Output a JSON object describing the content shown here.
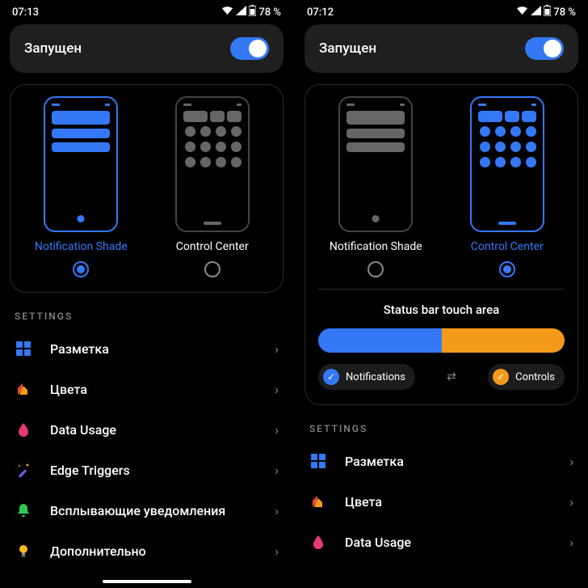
{
  "left": {
    "status": {
      "time": "07:13",
      "battery": "78 %"
    },
    "running_label": "Запущен",
    "modes": {
      "notif": "Notification Shade",
      "cc": "Control Center",
      "selected": "notif"
    },
    "settings_header": "SETTINGS",
    "settings": [
      {
        "label": "Разметка"
      },
      {
        "label": "Цвета"
      },
      {
        "label": "Data Usage"
      },
      {
        "label": "Edge Triggers"
      },
      {
        "label": "Всплывающие уведомления"
      },
      {
        "label": "Дополнительно"
      }
    ]
  },
  "right": {
    "status": {
      "time": "07:12",
      "battery": "78 %"
    },
    "running_label": "Запущен",
    "modes": {
      "notif": "Notification Shade",
      "cc": "Control Center",
      "selected": "cc"
    },
    "touch_area": {
      "title": "Status bar touch area",
      "left_label": "Notifications",
      "right_label": "Controls"
    },
    "settings_header": "SETTINGS",
    "settings": [
      {
        "label": "Разметка"
      },
      {
        "label": "Цвета"
      },
      {
        "label": "Data Usage"
      }
    ]
  }
}
